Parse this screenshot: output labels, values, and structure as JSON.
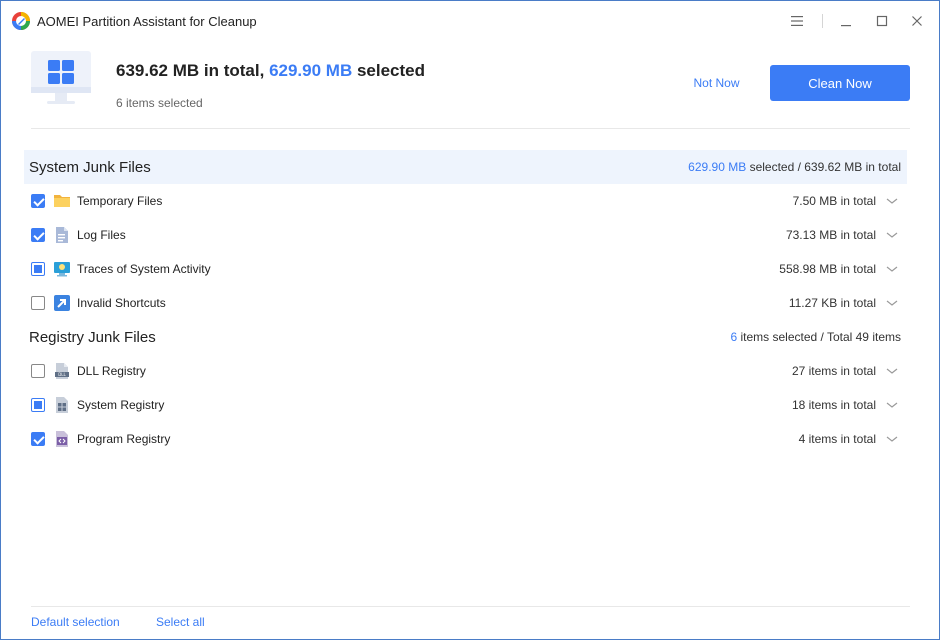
{
  "window": {
    "title": "AOMEI Partition Assistant for Cleanup",
    "accent_color": "#3b7cf5"
  },
  "header": {
    "total": "639.62 MB in total,",
    "selected": "629.90 MB",
    "selected_suffix": "selected",
    "items_selected": "6 items selected",
    "not_now_label": "Not Now",
    "clean_now_label": "Clean Now"
  },
  "system_junk": {
    "title": "System Junk Files",
    "selected_value": "629.90 MB",
    "stats_suffix": "selected / 639.62 MB in total",
    "items": [
      {
        "label": "Temporary Files",
        "value": "7.50 MB in total",
        "state": "checked",
        "icon": "folder-icon"
      },
      {
        "label": "Log Files",
        "value": "73.13 MB in total",
        "state": "checked",
        "icon": "log-file-icon"
      },
      {
        "label": "Traces of System Activity",
        "value": "558.98 MB in total",
        "state": "partial",
        "icon": "system-activity-icon"
      },
      {
        "label": "Invalid Shortcuts",
        "value": "11.27 KB in total",
        "state": "unchecked",
        "icon": "shortcut-icon"
      }
    ]
  },
  "registry_junk": {
    "title": "Registry Junk Files",
    "selected_value": "6",
    "stats_suffix": "items selected  /  Total 49 items",
    "items": [
      {
        "label": "DLL Registry",
        "value": "27 items in total",
        "state": "unchecked",
        "icon": "dll-icon"
      },
      {
        "label": "System Registry",
        "value": "18 items in total",
        "state": "partial",
        "icon": "system-registry-icon"
      },
      {
        "label": "Program Registry",
        "value": "4 items in total",
        "state": "checked",
        "icon": "program-registry-icon"
      }
    ]
  },
  "footer": {
    "default_selection": "Default selection",
    "select_all": "Select all"
  }
}
